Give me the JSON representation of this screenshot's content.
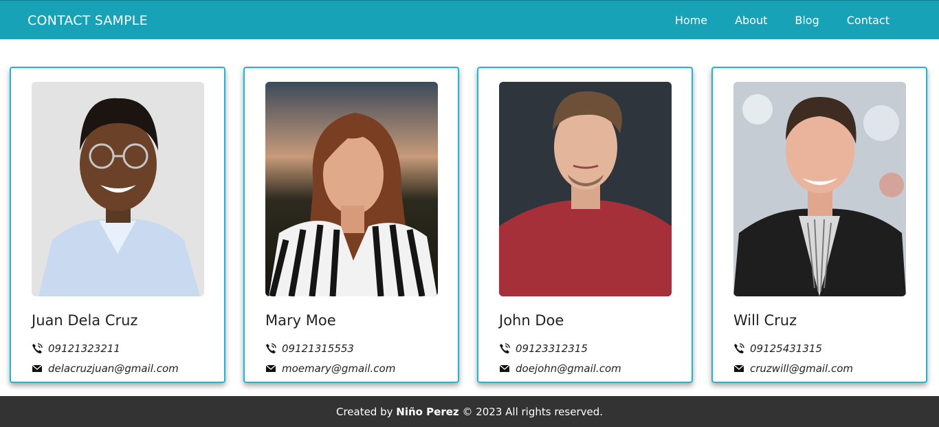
{
  "navbar": {
    "brand": "CONTACT SAMPLE",
    "links": [
      "Home",
      "About",
      "Blog",
      "Contact"
    ],
    "color": "#17a2b8"
  },
  "contacts": [
    {
      "name": "Juan Dela Cruz",
      "phone": "09121323211",
      "email": "delacruzjuan@gmail.com"
    },
    {
      "name": "Mary Moe",
      "phone": "09121315553",
      "email": "moemary@gmail.com"
    },
    {
      "name": "John Doe",
      "phone": "09123312315",
      "email": "doejohn@gmail.com"
    },
    {
      "name": "Will Cruz",
      "phone": "09125431315",
      "email": "cruzwill@gmail.com"
    }
  ],
  "footer": {
    "prefix": "Created by",
    "author": "Niño Perez",
    "suffix": "© 2023 All rights reserved.",
    "color": "#333333"
  },
  "icons": {
    "phone": "phone-icon",
    "email": "envelope-icon"
  },
  "accent_border": "#1fb4dc"
}
